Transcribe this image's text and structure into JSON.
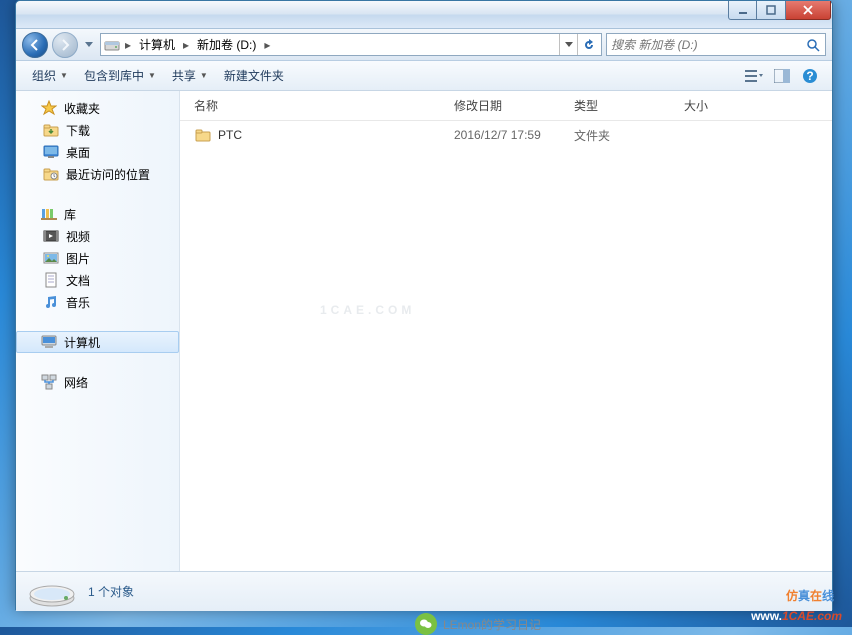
{
  "window": {
    "breadcrumb": [
      {
        "label": "计算机"
      },
      {
        "label": "新加卷 (D:)"
      }
    ],
    "search_placeholder": "搜索 新加卷 (D:)"
  },
  "toolbar": {
    "organize": "组织",
    "include": "包含到库中",
    "share": "共享",
    "newfolder": "新建文件夹"
  },
  "sidebar": {
    "favorites": {
      "label": "收藏夹",
      "items": [
        {
          "label": "下载"
        },
        {
          "label": "桌面"
        },
        {
          "label": "最近访问的位置"
        }
      ]
    },
    "libraries": {
      "label": "库",
      "items": [
        {
          "label": "视频"
        },
        {
          "label": "图片"
        },
        {
          "label": "文档"
        },
        {
          "label": "音乐"
        }
      ]
    },
    "computer": {
      "label": "计算机"
    },
    "network": {
      "label": "网络"
    }
  },
  "columns": {
    "name": "名称",
    "date": "修改日期",
    "type": "类型",
    "size": "大小"
  },
  "files": [
    {
      "name": "PTC",
      "date": "2016/12/7 17:59",
      "type": "文件夹",
      "size": ""
    }
  ],
  "status": {
    "count_label": "1 个对象"
  },
  "watermarks": {
    "center": "1CAE.COM",
    "footer": "LEmon的学习日记",
    "corner_cn": "仿真在线",
    "corner_url": "www.1CAE.com"
  }
}
